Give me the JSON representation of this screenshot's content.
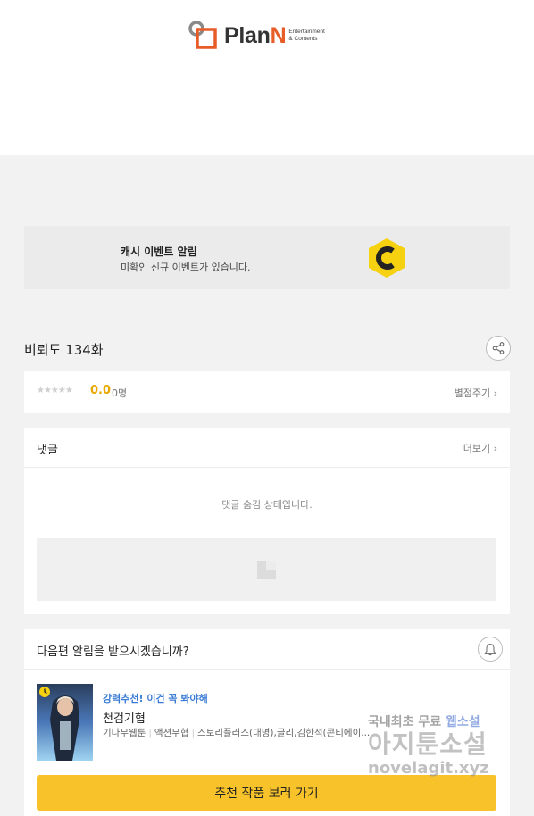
{
  "header": {
    "logo_text_main": "Plan",
    "logo_text_accent": "N",
    "logo_tag_line1": "Entertainment",
    "logo_tag_line2": "& Contents"
  },
  "cash_event": {
    "title": "캐시 이벤트 알림",
    "description": "미확인 신규 이벤트가 있습니다.",
    "coin_icon": "cash-coin-icon",
    "coin_color": "#f5d10f"
  },
  "episode": {
    "title": "비뢰도 134화",
    "share_icon": "share-icon"
  },
  "rating": {
    "stars": "★★★★★",
    "score": "0.0",
    "count": "0명",
    "rate_link": "별점주기 ›",
    "score_color": "#e8a800"
  },
  "comments": {
    "title": "댓글",
    "more_link": "더보기 ›",
    "hidden_message": "댓글 숨김 상태입니다."
  },
  "notification": {
    "title": "다음편 알림을 받으시겠습니까?",
    "bell_icon": "bell-icon",
    "recommend": {
      "tag": "강력추천! 이건 꼭 봐야해",
      "title": "천검기협",
      "genre1": "기다무웹툰",
      "genre2": "액션무협",
      "authors": "스토리플러스(대명),글리,김한석(콘티에이...",
      "button_label": "추천 작품 보러 가기",
      "button_color": "#f8c32a",
      "tag_color": "#3a7bd5"
    }
  },
  "watermark": {
    "line1": "국내최초 무료",
    "line1_accent": "웹소설",
    "line2": "아지툰소설",
    "line3": "novelagit.xyz"
  }
}
